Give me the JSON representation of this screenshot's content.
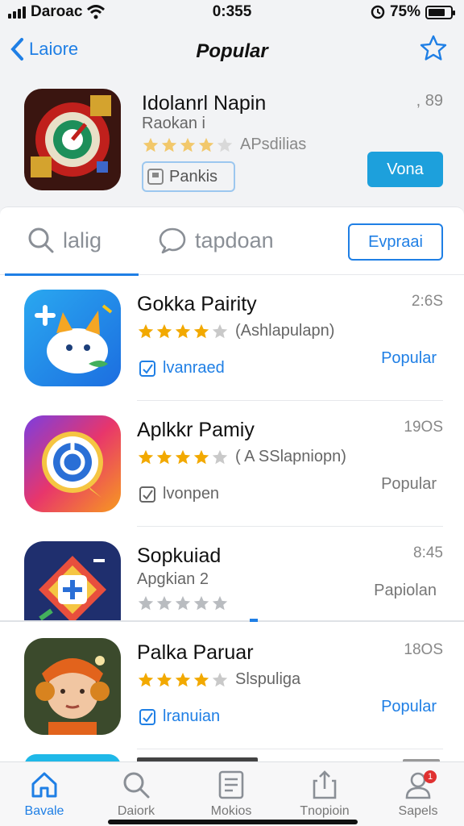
{
  "status_bar": {
    "carrier": "Daroac",
    "time": "0:355",
    "battery": "75%",
    "battery_level": 0.75
  },
  "nav": {
    "back_label": "Laiore",
    "title": "Popular"
  },
  "featured": {
    "name": "Idolanrl Napin",
    "subtitle": "Raokan i",
    "rating": 4,
    "rating_count": "APsdilias",
    "time": ", 89",
    "tag": "Pankis",
    "button": "Vona"
  },
  "tabs": {
    "search": "lalig",
    "chat": "tapdoan",
    "explore_button": "Evpraai"
  },
  "apps": [
    {
      "name": "Gokka Pairity",
      "time": "2:6S",
      "rating": 4,
      "rating_text": "(Ashlapulapn)",
      "tag": "lvanraed",
      "action": "Popular",
      "action_color": "#1f7fe5"
    },
    {
      "name": "Aplkkr Pamiy",
      "time": "19OS",
      "rating": 4,
      "rating_text": "( A SSlapniopn)",
      "tag": "lvonpen",
      "action": "Popular",
      "action_color": "#777777"
    },
    {
      "name": "Sopkuiad",
      "time": "8:45",
      "subtitle": "Apgkian 2",
      "rating": 0,
      "action": "Papiolan",
      "action_color": "#777777"
    },
    {
      "name": "Palka Paruar",
      "time": "18OS",
      "rating": 4,
      "rating_text": "Slspuliga",
      "tag": "lranuian",
      "action": "Popular",
      "action_color": "#1f7fe5"
    }
  ],
  "tab_bar": [
    {
      "label": "Bavale",
      "icon": "home-icon"
    },
    {
      "label": "Daiork",
      "icon": "search-icon"
    },
    {
      "label": "Mokios",
      "icon": "list-icon"
    },
    {
      "label": "Tnopioin",
      "icon": "share-icon"
    },
    {
      "label": "Sapels",
      "icon": "person-icon",
      "badge": "1"
    }
  ]
}
